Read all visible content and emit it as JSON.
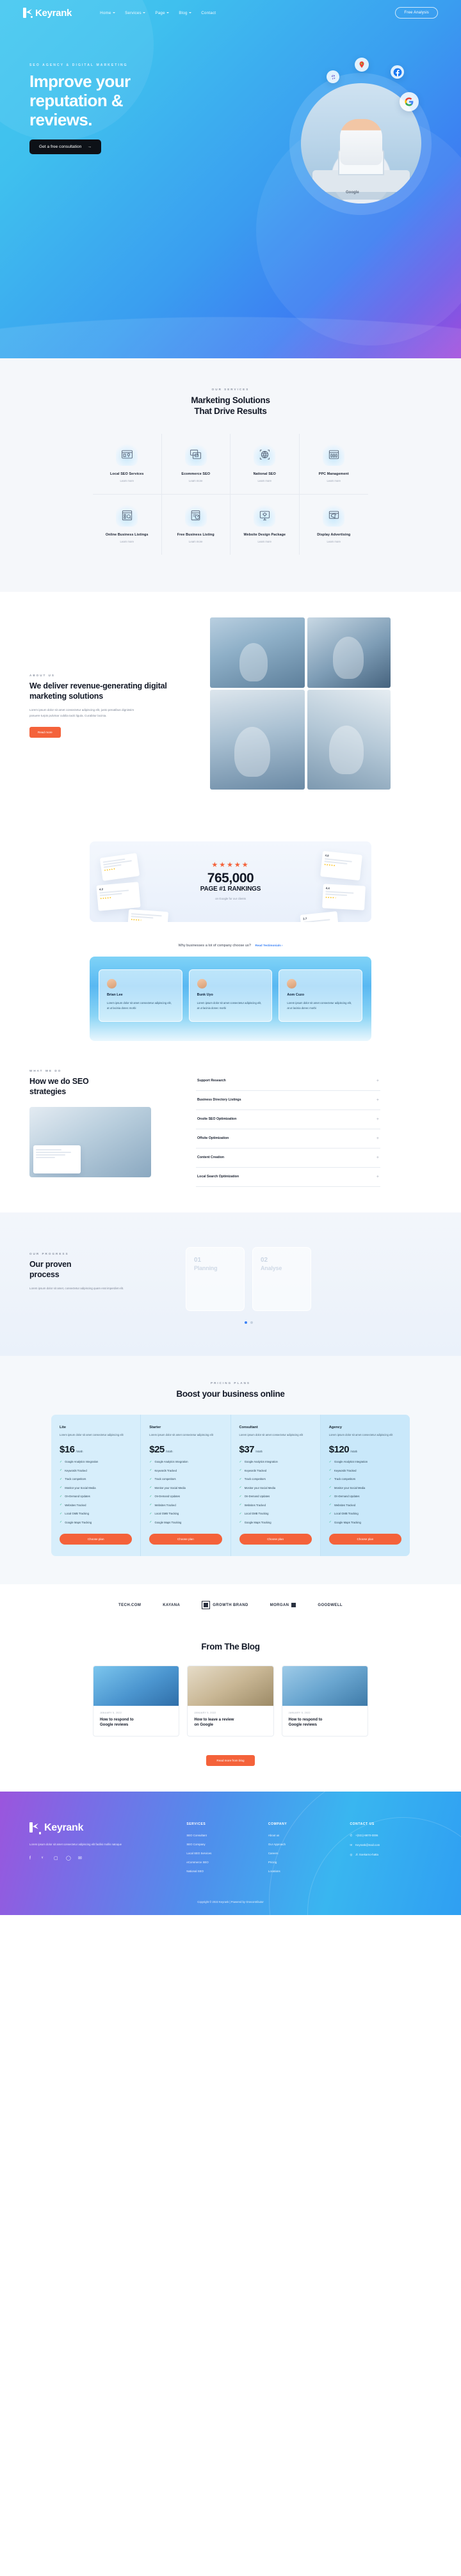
{
  "nav": {
    "brand": "Keyrank",
    "links": [
      {
        "label": "Home",
        "caret": true
      },
      {
        "label": "Services",
        "caret": true
      },
      {
        "label": "Page",
        "caret": true
      },
      {
        "label": "Blog",
        "caret": true
      },
      {
        "label": "Contact",
        "caret": false
      }
    ],
    "cta": "Free Analysis"
  },
  "hero": {
    "eyebrow": "SEO AGENCY & DIGITAL MARKETING",
    "title_line1": "Improve your",
    "title_line2": "reputation &",
    "title_line3": "reviews.",
    "button": "Get a free consultation",
    "button_arrow": "→",
    "google_label": "Google",
    "badges": [
      "google-icon",
      "maps-icon",
      "facebook-icon",
      "yelp-icon"
    ]
  },
  "services": {
    "kicker": "OUR SERVICES",
    "title_line1": "Marketing Solutions",
    "title_line2": "That Drive Results",
    "link_label": "Learn more",
    "items": [
      {
        "name": "Local SEO Services",
        "icon": "browser-pin-icon"
      },
      {
        "name": "Ecommerce SEO",
        "icon": "shop-window-icon"
      },
      {
        "name": "National SEO",
        "icon": "globe-target-icon"
      },
      {
        "name": "PPC Management",
        "icon": "dashboard-sliders-icon"
      },
      {
        "name": "Online Business Listings",
        "icon": "listing-lock-icon"
      },
      {
        "name": "Free Business Listing",
        "icon": "speed-gauge-icon"
      },
      {
        "name": "Website Design Package",
        "icon": "monitor-diamond-icon"
      },
      {
        "name": "Display Advertising",
        "icon": "megaphone-screen-icon"
      }
    ]
  },
  "about": {
    "kicker": "ABOUT US",
    "title": "We deliver revenue-generating digital marketing solutions",
    "paragraph": "Lorem ipsum dolor sit amet consectetur adipiscing elit, justo penatibus dignissim posuere turpis pulvinar cubilia taciti ligula. Curabitur lacinia.",
    "button": "Read more"
  },
  "stats": {
    "stars": "★★★★★",
    "number": "765,000",
    "subtitle": "PAGE #1 RANKINGS",
    "note": "on Google for our clients",
    "review_scores": [
      "4.2",
      "3.7",
      "4.8",
      "4.4",
      "4.6"
    ]
  },
  "why": {
    "line": "Why businesses a lot of company choose us?",
    "link": "Read Testimonials",
    "link_arrow": "›",
    "cards": [
      {
        "title": "Brian Lee",
        "text": "Lorem ipsum dolor sit amet consectetur adipiscing elit, at ut lacinia donec morbi"
      },
      {
        "title": "Bunk Uyo",
        "text": "Lorem ipsum dolor sit amet consectetur adipiscing elit, at ut lacinia donec morbi"
      },
      {
        "title": "Aom Cuzo",
        "text": "Lorem ipsum dolor sit amet consectetur adipiscing elit, at ut lacinia donec morbi"
      }
    ]
  },
  "seo": {
    "kicker": "WHAT WE DO",
    "title_line1": "How we do SEO",
    "title_line2": "strategies",
    "accordion": [
      {
        "label": "Support Research",
        "state": "+"
      },
      {
        "label": "Business Directory Listings",
        "state": "+"
      },
      {
        "label": "Onsite SEO Optimization",
        "state": "+"
      },
      {
        "label": "Offsite Optimization",
        "state": "+"
      },
      {
        "label": "Content Creation",
        "state": "+"
      },
      {
        "label": "Local Search Optimization",
        "state": "+"
      }
    ]
  },
  "process": {
    "kicker": "OUR PROGRESS",
    "title_line1": "Our proven",
    "title_line2": "process",
    "paragraph": "Lorem ipsum dolor sit amet, consectetur adipiscing quam erat imperdiet elit.",
    "cards": [
      {
        "num": "01",
        "title": "Planning"
      },
      {
        "num": "02",
        "title": "Analyse"
      }
    ],
    "dot_active_index": 0,
    "dot_count": 2
  },
  "pricing": {
    "kicker": "PRICING PLANS",
    "title": "Boost your business online",
    "features": [
      "Google Analytics Integration",
      "Keywords Tracked",
      "Track competitors",
      "Monitor your Social Media",
      "On-Demand Updates",
      "Websites Tracked",
      "Local GMB Tracking",
      "Google Maps Tracking"
    ],
    "button": "Choose plan",
    "per": "/ Month",
    "plans": [
      {
        "name": "Lite",
        "desc": "Lorem ipsum dolor sit amet consectetur adipiscing elit",
        "price": "$16"
      },
      {
        "name": "Starter",
        "desc": "Lorem ipsum dolor sit amet consectetur adipiscing elit",
        "price": "$25"
      },
      {
        "name": "Consultant",
        "desc": "Lorem ipsum dolor sit amet consectetur adipiscing elit",
        "price": "$37"
      },
      {
        "name": "Agency",
        "desc": "Lorem ipsum dolor sit amet consectetur adipiscing elit",
        "price": "$120"
      }
    ]
  },
  "brands": [
    {
      "label": "TECH.COM"
    },
    {
      "label": "KAYANA"
    },
    {
      "label": "GROWTH BRAND"
    },
    {
      "label": "MORGAN"
    },
    {
      "label": "GOODWELL"
    }
  ],
  "blog": {
    "title": "From The Blog",
    "cta": "Read more from blog",
    "posts": [
      {
        "meta": "JANUARY 5, 2022",
        "title_line1": "How to respond to",
        "title_line2": "Google reviews",
        "image": "post-image-1"
      },
      {
        "meta": "JANUARY 5, 2022",
        "title_line1": "How to leave a review",
        "title_line2": "on Google",
        "image": "post-image-2"
      },
      {
        "meta": "JANUARY 5, 2022",
        "title_line1": "How to respond to",
        "title_line2": "Google reviews",
        "image": "post-image-3"
      }
    ]
  },
  "footer": {
    "brand": "Keyrank",
    "desc": "Lorem ipsum dolor sit amet consectetur adipiscing elit facilisi mollis natoque",
    "social": [
      "facebook-icon",
      "twitter-icon",
      "instagram-icon",
      "whatsapp-icon",
      "mail-icon"
    ],
    "social_glyphs": [
      "f",
      "ᵛ",
      "▢",
      "◯",
      "✉"
    ],
    "columns": [
      {
        "head": "SERVICES",
        "items": [
          "SEO Consultant",
          "SEO Company",
          "Local SEO Services",
          "eCommerce SEO",
          "National SEO"
        ]
      },
      {
        "head": "COMPANY",
        "items": [
          "About us",
          "Our Approach",
          "Careers",
          "Pricing",
          "Locations"
        ]
      }
    ],
    "contact": {
      "head": "CONTACT US",
      "items": [
        {
          "icon": "phone-icon",
          "glyph": "✆",
          "text": "+(021)-9870-0006"
        },
        {
          "icon": "mail-icon",
          "glyph": "✉",
          "text": "Keyrank@mail.com"
        },
        {
          "icon": "location-icon",
          "glyph": "◎",
          "text": "Jl. Soekarno-hatta"
        }
      ]
    },
    "copyright": "Copyright © 2022 Keyrank | Powered by Onecontributor"
  },
  "colors": {
    "accent_orange": "#f4623a",
    "accent_blue": "#3b82f6",
    "dark": "#121826",
    "star": "#f4623a"
  }
}
